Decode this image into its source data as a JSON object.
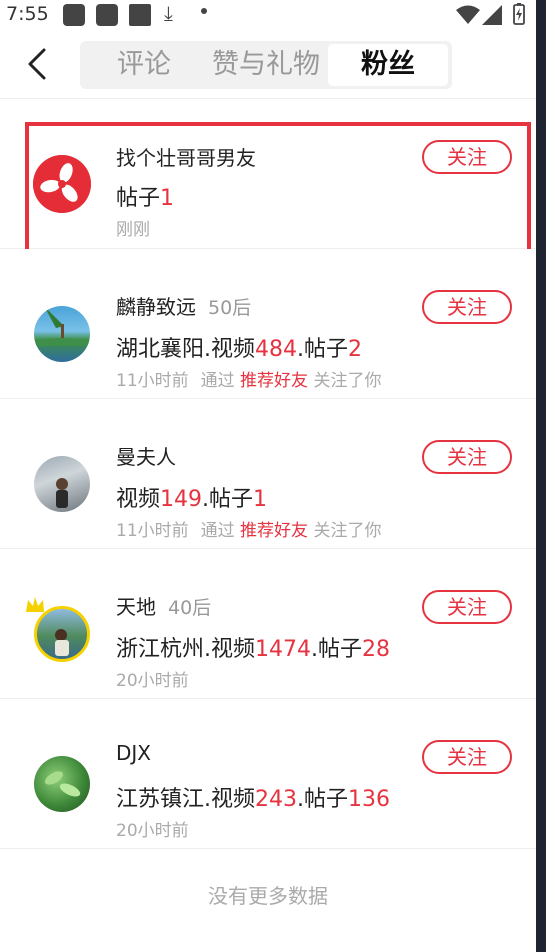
{
  "status_bar": {
    "time": "7:55"
  },
  "header": {
    "tabs": [
      {
        "label": "评论",
        "active": false
      },
      {
        "label": "赞与礼物",
        "active": false
      },
      {
        "label": "粉丝",
        "active": true
      }
    ]
  },
  "followers": [
    {
      "name": "找个壮哥哥男友",
      "age": "",
      "info_prefix": "帖子",
      "info_value": "1",
      "time": "刚刚",
      "via_prefix": "",
      "via_link": "",
      "via_suffix": "",
      "follow_label": "关注",
      "selected": true
    },
    {
      "name": "麟静致远",
      "age": "50后",
      "info_prefix": "湖北襄阳.视频",
      "info_value": "484",
      "info_prefix2": ".帖子",
      "info_value2": "2",
      "time": "11小时前",
      "via_prefix": "通过",
      "via_link": "推荐好友",
      "via_suffix": "关注了你",
      "follow_label": "关注"
    },
    {
      "name": "曼夫人",
      "age": "",
      "info_prefix": "视频",
      "info_value": "149",
      "info_prefix2": ".帖子",
      "info_value2": "1",
      "time": "11小时前",
      "via_prefix": "通过",
      "via_link": "推荐好友",
      "via_suffix": "关注了你",
      "follow_label": "关注"
    },
    {
      "name": "天地",
      "age": "40后",
      "info_prefix": "浙江杭州.视频",
      "info_value": "1474",
      "info_prefix2": ".帖子",
      "info_value2": "28",
      "time": "20小时前",
      "follow_label": "关注"
    },
    {
      "name": "DJX",
      "age": "",
      "info_prefix": "江苏镇江.视频",
      "info_value": "243",
      "info_prefix2": ".帖子",
      "info_value2": "136",
      "time": "20小时前",
      "follow_label": "关注"
    }
  ],
  "footer": {
    "no_more": "没有更多数据"
  },
  "colors": {
    "accent_red": "#e53340",
    "muted": "#aaaaaa",
    "tab_bg": "#f1f1f1"
  }
}
